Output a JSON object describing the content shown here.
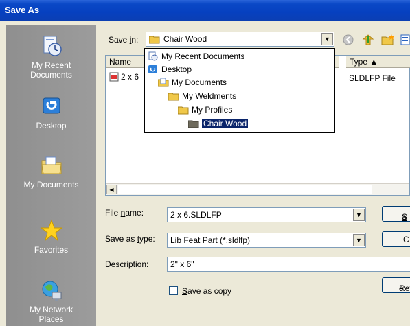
{
  "window": {
    "title": "Save As"
  },
  "places": [
    {
      "label_line1": "My Recent",
      "label_line2": "Documents",
      "icon": "recent-documents-icon"
    },
    {
      "label_line1": "Desktop",
      "label_line2": "",
      "icon": "desktop-icon"
    },
    {
      "label_line1": "My Documents",
      "label_line2": "",
      "icon": "my-documents-icon"
    },
    {
      "label_line1": "Favorites",
      "label_line2": "",
      "icon": "favorites-icon"
    },
    {
      "label_line1": "My Network",
      "label_line2": "Places",
      "icon": "network-places-icon"
    }
  ],
  "save_in": {
    "label_pre": "Save ",
    "label_u": "i",
    "label_post": "n:",
    "value": "Chair Wood"
  },
  "toolbar": {
    "back_icon": "back-icon",
    "up_icon": "up-folder-icon",
    "new_folder_icon": "new-folder-icon",
    "views_icon": "views-icon"
  },
  "file_list": {
    "columns": [
      {
        "label": "Name"
      },
      {
        "label": "Type ▲"
      }
    ],
    "rows": [
      {
        "name": "2 x 6",
        "type": "SLDLFP File"
      }
    ]
  },
  "dropdown": {
    "items": [
      {
        "label": "My Recent Documents",
        "icon": "recent-documents-icon"
      },
      {
        "label": "Desktop",
        "icon": "desktop-icon"
      },
      {
        "label": "My Documents",
        "icon": "folder-icon"
      },
      {
        "label": "My Weldments",
        "icon": "folder-icon"
      },
      {
        "label": "My Profiles",
        "icon": "folder-icon"
      },
      {
        "label": "Chair Wood",
        "icon": "open-folder-icon",
        "selected": true
      }
    ]
  },
  "file_name": {
    "label_pre": "File ",
    "label_u": "n",
    "label_post": "ame:",
    "value": "2 x 6.SLDLFP"
  },
  "save_as_type": {
    "label_pre": "Save as ",
    "label_u": "t",
    "label_post": "ype:",
    "value": "Lib Feat Part (*.sldlfp)"
  },
  "description": {
    "label": "Description:",
    "value": "2\" x 6\""
  },
  "save_as_copy": {
    "label_pre": "",
    "label_u": "S",
    "label_post": "ave as copy",
    "checked": false
  },
  "buttons": {
    "save": {
      "label_u": "S",
      "label_post": "a"
    },
    "cancel": {
      "label": "C"
    },
    "references": {
      "label_pre": "Ref",
      "label_u": "e",
      "label_post": ""
    }
  }
}
